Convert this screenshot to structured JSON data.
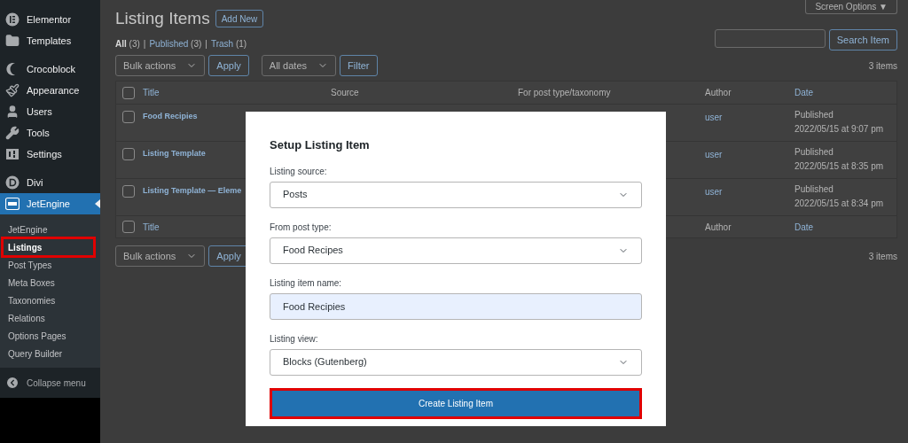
{
  "sidebar": {
    "groups": [
      [
        {
          "label": "Elementor",
          "kind": "elementor",
          "selected": false
        },
        {
          "label": "Templates",
          "kind": "folder",
          "selected": false
        }
      ],
      [
        {
          "label": "Crocoblock",
          "kind": "croco",
          "selected": false
        },
        {
          "label": "Appearance",
          "kind": "brush",
          "selected": false
        },
        {
          "label": "Users",
          "kind": "user",
          "selected": false
        },
        {
          "label": "Tools",
          "kind": "wrench",
          "selected": false
        },
        {
          "label": "Settings",
          "kind": "settings",
          "selected": false
        }
      ],
      [
        {
          "label": "Divi",
          "kind": "divi",
          "selected": false
        },
        {
          "label": "JetEngine",
          "kind": "jet",
          "selected": true
        }
      ]
    ],
    "submenu": [
      {
        "label": "JetEngine",
        "selected": false,
        "highlighted": false
      },
      {
        "label": "Listings",
        "selected": true,
        "highlighted": true
      },
      {
        "label": "Post Types",
        "selected": false,
        "highlighted": false
      },
      {
        "label": "Meta Boxes",
        "selected": false,
        "highlighted": false
      },
      {
        "label": "Taxonomies",
        "selected": false,
        "highlighted": false
      },
      {
        "label": "Relations",
        "selected": false,
        "highlighted": false
      },
      {
        "label": "Options Pages",
        "selected": false,
        "highlighted": false
      },
      {
        "label": "Query Builder",
        "selected": false,
        "highlighted": false
      }
    ],
    "collapse": "Collapse menu"
  },
  "page": {
    "title": "Listing Items",
    "add_new": "Add New",
    "screen_options": "Screen Options ▼",
    "views": [
      {
        "label": "All",
        "count": "(3)",
        "selected": true
      },
      {
        "separator": "|",
        "label": "Published",
        "count": "(3)",
        "selected": false
      },
      {
        "separator": "|",
        "label": "Trash",
        "count": "(1)",
        "selected": false
      }
    ],
    "search_button": "Search Item",
    "top_actions": {
      "bulk_actions": "Bulk actions",
      "apply": "Apply",
      "dates": "All dates",
      "filter": "Filter",
      "count": "3 items"
    },
    "bottom_actions": {
      "bulk_actions": "Bulk actions",
      "apply": "Apply",
      "count": "3 items"
    }
  },
  "table": {
    "header": {
      "checked": false,
      "columns": [
        "Title",
        "Source",
        "For post type/taxonomy",
        "Author",
        "Date"
      ]
    },
    "rows": [
      {
        "checked": false,
        "title": "Food Recipies",
        "author": "user",
        "status": "Published",
        "date": "2022/05/15 at 9:07 pm"
      },
      {
        "checked": false,
        "title": "Listing Template",
        "author": "user",
        "status": "Published",
        "date": "2022/05/15 at 8:35 pm"
      },
      {
        "checked": false,
        "title": "Listing Template — Eleme",
        "author": "user",
        "status": "Published",
        "date": "2022/05/15 at 8:34 pm"
      }
    ],
    "footer": {
      "checked": false,
      "title": "Title",
      "author": "Author",
      "date": "Date"
    }
  },
  "dialog": {
    "title": "Setup Listing Item",
    "fields": [
      {
        "kind": "select",
        "label": "Listing source:",
        "value": "Posts"
      },
      {
        "kind": "select",
        "label": "From post type:",
        "value": "Food Recipes"
      },
      {
        "kind": "input",
        "label": "Listing item name:",
        "value": "Food Recipies"
      },
      {
        "kind": "select",
        "label": "Listing view:",
        "value": "Blocks (Gutenberg)"
      }
    ],
    "button": {
      "label": "Create Listing Item",
      "highlighted": true
    }
  }
}
